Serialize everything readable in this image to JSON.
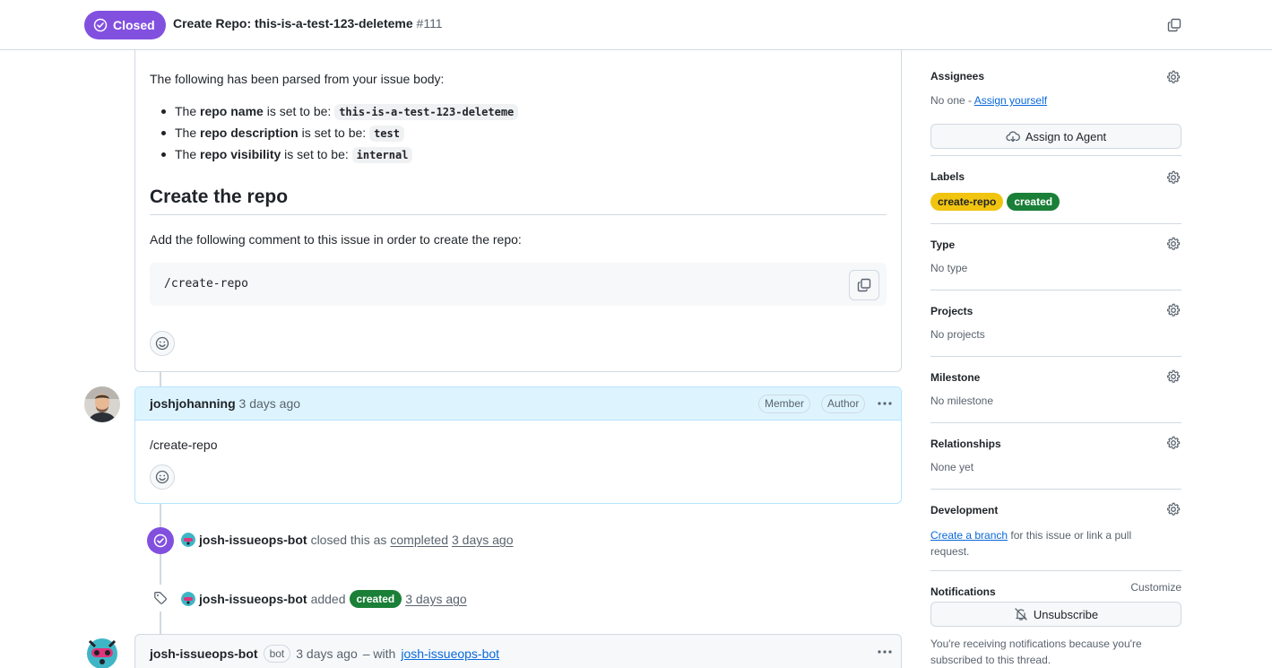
{
  "header": {
    "state_label": "Closed",
    "title": "Create Repo: this-is-a-test-123-deleteme",
    "number": "#111"
  },
  "first_comment": {
    "intro": "The following has been parsed from your issue body:",
    "items": [
      {
        "pre": "The ",
        "field": "repo name",
        "mid": " is set to be: ",
        "value": "this-is-a-test-123-deleteme"
      },
      {
        "pre": "The ",
        "field": "repo description",
        "mid": " is set to be: ",
        "value": "test"
      },
      {
        "pre": "The ",
        "field": "repo visibility",
        "mid": " is set to be: ",
        "value": "internal"
      }
    ],
    "heading": "Create the repo",
    "instruction": "Add the following comment to this issue in order to create the repo:",
    "code": "/create-repo"
  },
  "comment": {
    "author": "joshjohanning",
    "time": "3 days ago",
    "badges": [
      "Member",
      "Author"
    ],
    "body": "/create-repo"
  },
  "events": {
    "closed": {
      "actor": "josh-issueops-bot",
      "text": "closed this as",
      "reason": "completed",
      "time": "3 days ago"
    },
    "labeled": {
      "actor": "josh-issueops-bot",
      "text": "added",
      "label": "created",
      "time": "3 days ago"
    }
  },
  "bot_comment": {
    "author": "josh-issueops-bot",
    "badge": "bot",
    "time": "3 days ago",
    "with_text": "– with",
    "app": "josh-issueops-bot"
  },
  "sidebar": {
    "assignees": {
      "title": "Assignees",
      "empty": "No one - ",
      "link": "Assign yourself",
      "button": "Assign to Agent"
    },
    "labels": {
      "title": "Labels",
      "items": [
        {
          "name": "create-repo",
          "color": "#f1c40f",
          "text_color": "#1f2328"
        },
        {
          "name": "created",
          "color": "#1a7f37",
          "text_color": "#ffffff"
        }
      ]
    },
    "type": {
      "title": "Type",
      "value": "No type"
    },
    "projects": {
      "title": "Projects",
      "value": "No projects"
    },
    "milestone": {
      "title": "Milestone",
      "value": "No milestone"
    },
    "relationships": {
      "title": "Relationships",
      "value": "None yet"
    },
    "development": {
      "title": "Development",
      "link": "Create a branch",
      "rest1": " for this issue or link a pull",
      "rest2": "request."
    },
    "notifications": {
      "title": "Notifications",
      "customize": "Customize",
      "button": "Unsubscribe",
      "note1": "You're receiving notifications because you're",
      "note2": "subscribed to this thread."
    }
  },
  "colors": {
    "closed_purple": "#8250df",
    "link_blue": "#0969da",
    "created_green": "#1a7f37",
    "create_repo_yellow": "#f1c40f"
  }
}
